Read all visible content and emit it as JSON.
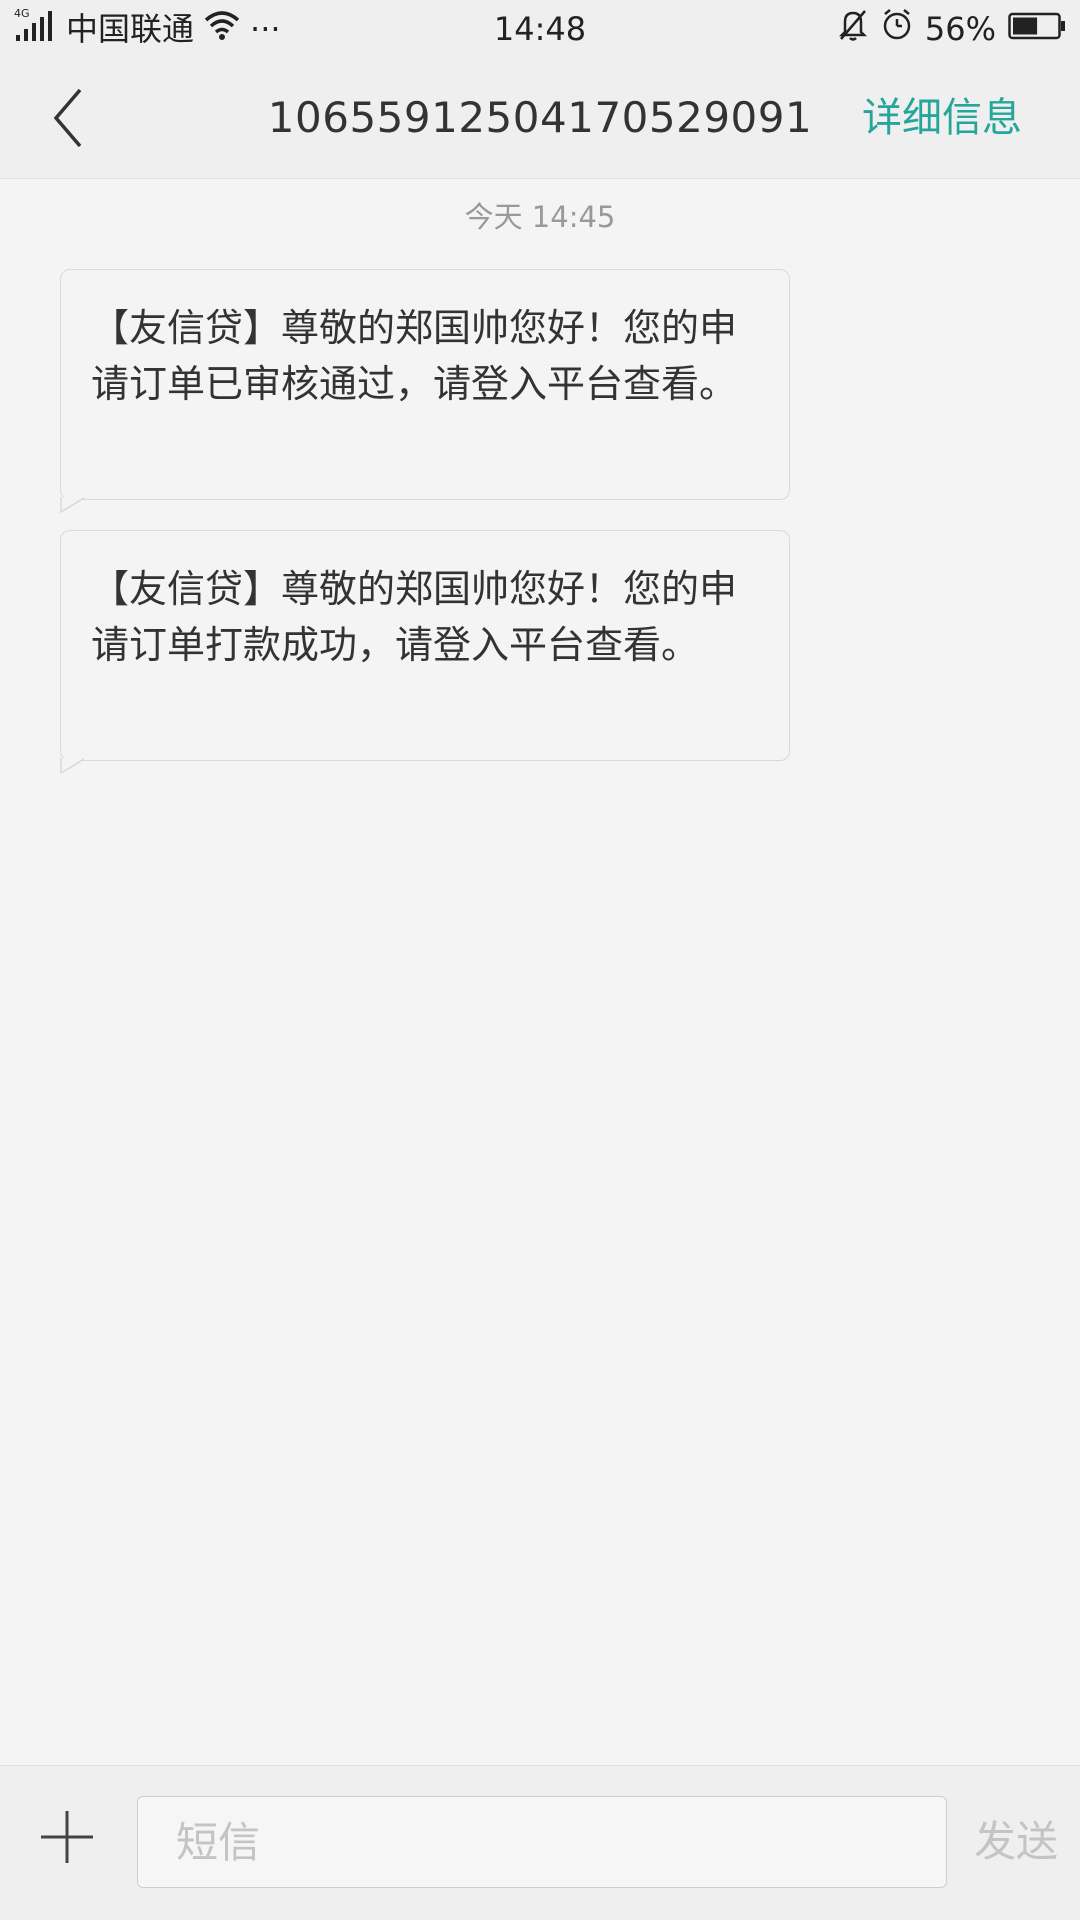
{
  "status_bar": {
    "network_type": "4G",
    "carrier": "中国联通",
    "more": "···",
    "time": "14:48",
    "battery_percent": "56%",
    "battery_level": 0.56,
    "icons": [
      "signal-icon",
      "wifi-icon",
      "mute-bell-icon",
      "alarm-icon",
      "battery-icon"
    ]
  },
  "header": {
    "title": "10655912504170529091",
    "details_label": "详细信息",
    "accent_color": "#26a69a"
  },
  "messages": {
    "timestamp": "今天 14:45",
    "items": [
      {
        "text": "【友信贷】尊敬的郑国帅您好！您的申请订单已审核通过，请登入平台查看。"
      },
      {
        "text": "【友信贷】尊敬的郑国帅您好！您的申请订单打款成功，请登入平台查看。"
      }
    ]
  },
  "compose": {
    "placeholder": "短信",
    "send_label": "发送"
  }
}
